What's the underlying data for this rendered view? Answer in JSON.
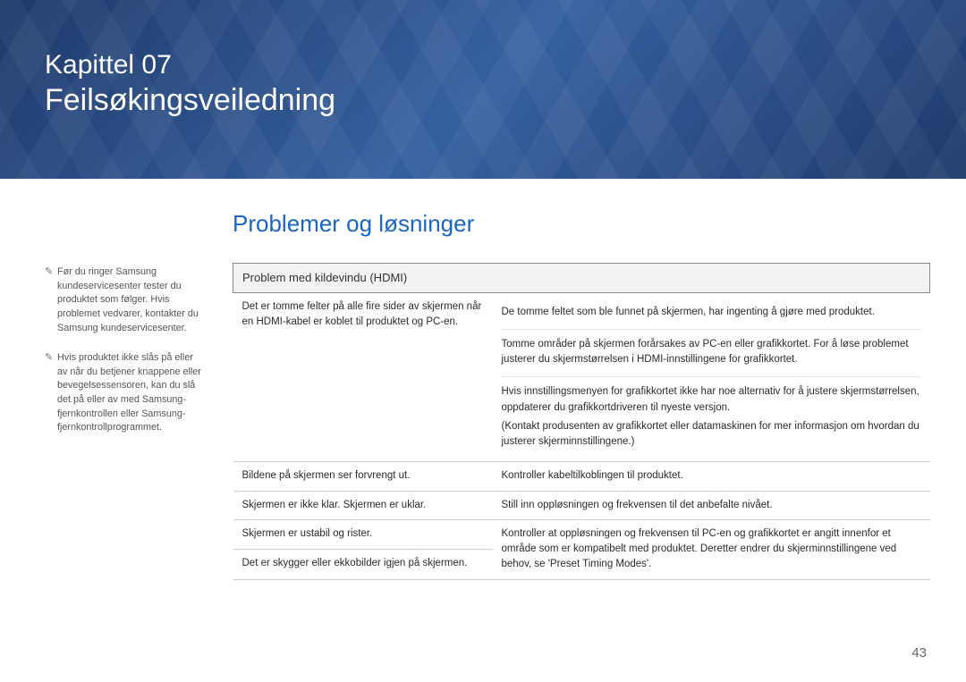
{
  "hero": {
    "chapter": "Kapittel 07",
    "title": "Feilsøkingsveiledning"
  },
  "section_title": "Problemer og løsninger",
  "notes": [
    "Før du ringer Samsung kundeservicesenter tester du produktet som følger. Hvis problemet vedvarer, kontakter du Samsung kundeservicesenter.",
    "Hvis produktet ikke slås på eller av når du betjener knappene eller bevegelsessensoren, kan du slå det på eller av med Samsung-fjernkontrollen eller Samsung-fjernkontrollprogrammet."
  ],
  "table": {
    "header": "Problem med kildevindu (HDMI)",
    "rows": [
      {
        "problem": "Det er tomme felter på alle fire sider av skjermen når en HDMI-kabel er koblet til produktet og PC-en.",
        "solutions": [
          "De tomme feltet som ble funnet på skjermen, har ingenting å gjøre med produktet.",
          "Tomme områder på skjermen forårsakes av PC-en eller grafikkortet. For å løse problemet justerer du skjermstørrelsen i HDMI-innstillingene for grafikkortet.",
          "Hvis innstillingsmenyen for grafikkortet ikke har noe alternativ for å justere skjermstørrelsen, oppdaterer du grafikkortdriveren til nyeste versjon.",
          "(Kontakt produsenten av grafikkortet eller datamaskinen for mer informasjon om hvordan du justerer skjerminnstillingene.)"
        ]
      },
      {
        "problem": "Bildene på skjermen ser forvrengt ut.",
        "solutions": [
          "Kontroller kabeltilkoblingen til produktet."
        ]
      },
      {
        "problem": "Skjermen er ikke klar. Skjermen er uklar.",
        "solutions": [
          "Still inn oppløsningen og frekvensen til det anbefalte nivået."
        ]
      },
      {
        "problem": "Skjermen er ustabil og rister.",
        "solutions": [
          "Kontroller at oppløsningen og frekvensen til PC-en og grafikkortet er angitt innenfor et område som er kompatibelt med produktet. Deretter endrer du skjerminnstillingene ved behov, se 'Preset Timing Modes'."
        ]
      },
      {
        "problem": "Det er skygger eller ekkobilder igjen på skjermen.",
        "solutions": [
          ""
        ]
      }
    ]
  },
  "page_number": "43"
}
